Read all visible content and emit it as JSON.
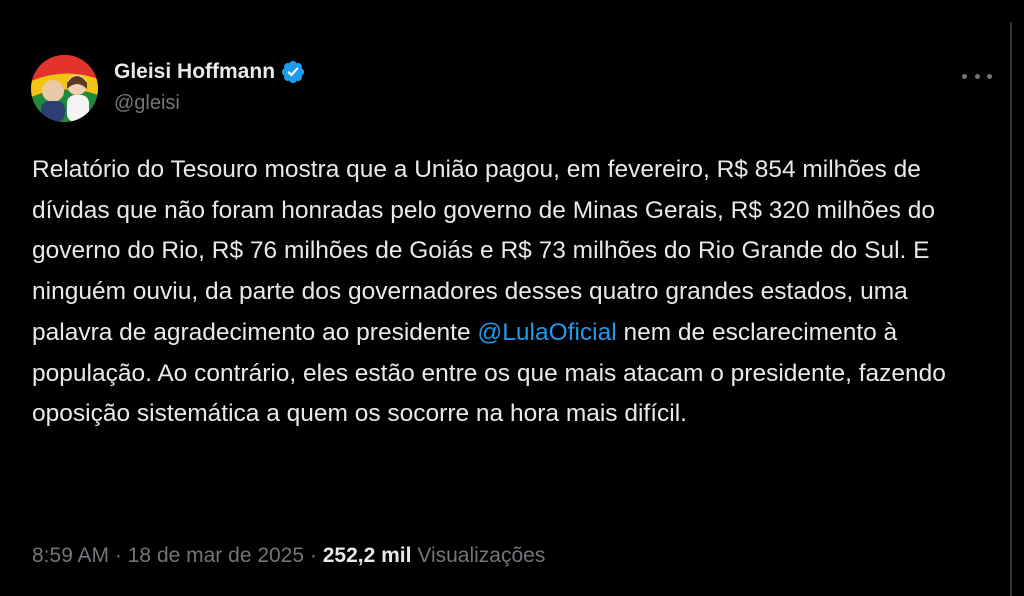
{
  "top_fragment": "",
  "tweet": {
    "author": {
      "display_name": "Gleisi Hoffmann",
      "handle": "@gleisi",
      "verified": true,
      "avatar_icon": "profile-photo"
    },
    "text_before_mention": "Relatório do Tesouro mostra que a União pagou, em fevereiro, R$ 854 milhões de dívidas que não foram honradas pelo governo de Minas Gerais, R$ 320 milhões do governo do Rio, R$ 76 milhões de Goiás e R$ 73 milhões do Rio Grande do Sul. E ninguém ouviu, da parte dos governadores desses quatro grandes estados, uma palavra de agradecimento ao presidente ",
    "mention": "@LulaOficial",
    "text_after_mention": " nem de esclarecimento à população. Ao contrário, eles estão entre os que mais atacam o presidente, fazendo oposição sistemática a quem os socorre na hora mais difícil.",
    "time": "8:59 AM",
    "separator": "·",
    "date": "18 de mar de 2025",
    "views_count": "252,2 mil",
    "views_label": "Visualizações"
  },
  "colors": {
    "background": "#000000",
    "text": "#e7e9ea",
    "secondary": "#71767b",
    "accent": "#1d9bf0"
  }
}
